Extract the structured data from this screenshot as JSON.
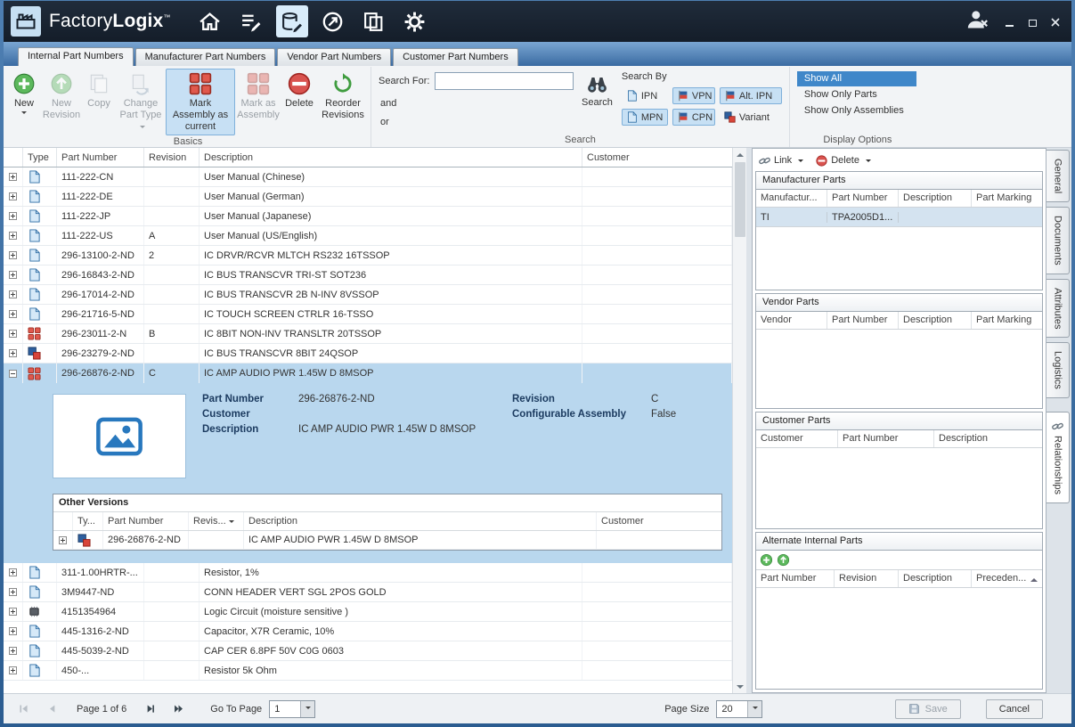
{
  "titlebar": {
    "brand_factory": "Factory",
    "brand_logix": "Logix",
    "brand_tm": "™"
  },
  "tabs": [
    "Internal Part Numbers",
    "Manufacturer Part Numbers",
    "Vendor Part Numbers",
    "Customer Part Numbers"
  ],
  "ribbon": {
    "new": "New",
    "new_revision": "New Revision",
    "copy": "Copy",
    "change_part_type": "Change Part Type",
    "mark_assembly_current": "Mark Assembly as current",
    "mark_as_assembly": "Mark as Assembly",
    "delete": "Delete",
    "reorder_revisions": "Reorder Revisions",
    "basics_group": "Basics",
    "search_for": "Search For:",
    "search_value": "",
    "and": "and",
    "or": "or",
    "search_button": "Search",
    "search_by": "Search By",
    "chips": [
      {
        "label": "IPN",
        "icon": "document-icon",
        "active": false
      },
      {
        "label": "VPN",
        "icon": "flag-icon",
        "active": true
      },
      {
        "label": "Alt. IPN",
        "icon": "flag-icon",
        "active": true
      },
      {
        "label": "MPN",
        "icon": "document-icon",
        "active": true
      },
      {
        "label": "CPN",
        "icon": "flag-icon",
        "active": true
      },
      {
        "label": "Variant",
        "icon": "grid-icon",
        "active": false
      }
    ],
    "search_group": "Search",
    "show_all": "Show All",
    "show_only_parts": "Show Only Parts",
    "show_only_assemblies": "Show Only Assemblies",
    "display_group": "Display Options"
  },
  "grid": {
    "headers": {
      "type": "Type",
      "part_number": "Part Number",
      "revision": "Revision",
      "description": "Description",
      "customer": "Customer"
    },
    "rows": [
      {
        "icon": "document-icon",
        "part_number": "111-222-CN",
        "revision": "",
        "description": "User Manual (Chinese)",
        "customer": ""
      },
      {
        "icon": "document-icon",
        "part_number": "111-222-DE",
        "revision": "",
        "description": "User Manual (German)",
        "customer": ""
      },
      {
        "icon": "document-icon",
        "part_number": "111-222-JP",
        "revision": "",
        "description": "User Manual (Japanese)",
        "customer": ""
      },
      {
        "icon": "document-icon",
        "part_number": "111-222-US",
        "revision": "A",
        "description": "User Manual (US/English)",
        "customer": ""
      },
      {
        "icon": "document-icon",
        "part_number": "296-13100-2-ND",
        "revision": "2",
        "description": "IC DRVR/RCVR MLTCH RS232 16TSSOP",
        "customer": ""
      },
      {
        "icon": "document-icon",
        "part_number": "296-16843-2-ND",
        "revision": "",
        "description": "IC BUS TRANSCVR TRI-ST SOT236",
        "customer": ""
      },
      {
        "icon": "document-icon",
        "part_number": "296-17014-2-ND",
        "revision": "",
        "description": "IC BUS TRANSCVR 2B N-INV 8VSSOP",
        "customer": ""
      },
      {
        "icon": "document-icon",
        "part_number": "296-21716-5-ND",
        "revision": "",
        "description": "IC TOUCH SCREEN CTRLR 16-TSSO",
        "customer": ""
      },
      {
        "icon": "assembly-grid-icon",
        "part_number": "296-23011-2-N",
        "revision": "B",
        "description": "IC 8BIT NON-INV TRANSLTR 20TSSOP",
        "customer": ""
      },
      {
        "icon": "assembly-mixed-icon",
        "part_number": "296-23279-2-ND",
        "revision": "",
        "description": "IC BUS TRANSCVR 8BIT 24QSOP",
        "customer": ""
      },
      {
        "icon": "assembly-grid-icon",
        "part_number": "296-26876-2-ND",
        "revision": "C",
        "description": "IC AMP AUDIO PWR 1.45W D 8MSOP",
        "customer": "",
        "selected": true
      },
      {
        "icon": "document-icon",
        "part_number": "311-1.00HRTR-...",
        "revision": "",
        "description": "Resistor, 1%",
        "customer": ""
      },
      {
        "icon": "document-icon",
        "part_number": "3M9447-ND",
        "revision": "",
        "description": "CONN HEADER VERT SGL 2POS GOLD",
        "customer": ""
      },
      {
        "icon": "chip-icon",
        "part_number": "4151354964",
        "revision": "",
        "description": "Logic Circuit (moisture sensitive )",
        "customer": ""
      },
      {
        "icon": "document-icon",
        "part_number": "445-1316-2-ND",
        "revision": "",
        "description": "Capacitor,  X7R Ceramic, 10%",
        "customer": ""
      },
      {
        "icon": "document-icon",
        "part_number": "445-5039-2-ND",
        "revision": "",
        "description": "CAP CER 6.8PF 50V C0G 0603",
        "customer": ""
      },
      {
        "icon": "document-icon",
        "part_number": "450-...",
        "revision": "",
        "description": "Resistor 5k Ohm",
        "customer": ""
      }
    ]
  },
  "detail": {
    "part_number_label": "Part Number",
    "part_number": "296-26876-2-ND",
    "customer_label": "Customer",
    "customer": "",
    "description_label": "Description",
    "description": "IC AMP AUDIO PWR 1.45W D 8MSOP",
    "revision_label": "Revision",
    "revision": "C",
    "configurable_label": "Configurable Assembly",
    "configurable": "False",
    "other_versions": {
      "title": "Other Versions",
      "headers": {
        "type": "Ty...",
        "part_number": "Part Number",
        "revision": "Revis...",
        "description": "Description",
        "customer": "Customer"
      },
      "row": {
        "icon": "assembly-mixed-icon",
        "part_number": "296-26876-2-ND",
        "revision": "",
        "description": "IC AMP AUDIO PWR 1.45W D 8MSOP",
        "customer": ""
      }
    }
  },
  "relationships": {
    "link_button": "Link",
    "delete_button": "Delete",
    "manufacturer_parts": {
      "title": "Manufacturer Parts",
      "headers": [
        "Manufactur...",
        "Part Number",
        "Description",
        "Part Marking"
      ],
      "rows": [
        {
          "manufacturer": "TI",
          "part_number": "TPA2005D1...",
          "description": "",
          "part_marking": ""
        }
      ]
    },
    "vendor_parts": {
      "title": "Vendor Parts",
      "headers": [
        "Vendor",
        "Part Number",
        "Description",
        "Part Marking"
      ],
      "rows": []
    },
    "customer_parts": {
      "title": "Customer Parts",
      "headers": [
        "Customer",
        "Part Number",
        "Description"
      ],
      "rows": []
    },
    "alternate_parts": {
      "title": "Alternate Internal Parts",
      "headers": [
        "Part Number",
        "Revision",
        "Description",
        "Preceden..."
      ],
      "rows": []
    }
  },
  "side_tabs": [
    {
      "label": "General",
      "active": false
    },
    {
      "label": "Documents",
      "active": false
    },
    {
      "label": "Attributes",
      "active": false
    },
    {
      "label": "Logistics",
      "active": false
    },
    {
      "label": "Relationships",
      "active": true
    }
  ],
  "footer": {
    "page_info": "Page 1 of 6",
    "goto_label": "Go To Page",
    "goto_value": "1",
    "page_size_label": "Page Size",
    "page_size_value": "20",
    "save": "Save",
    "cancel": "Cancel"
  }
}
